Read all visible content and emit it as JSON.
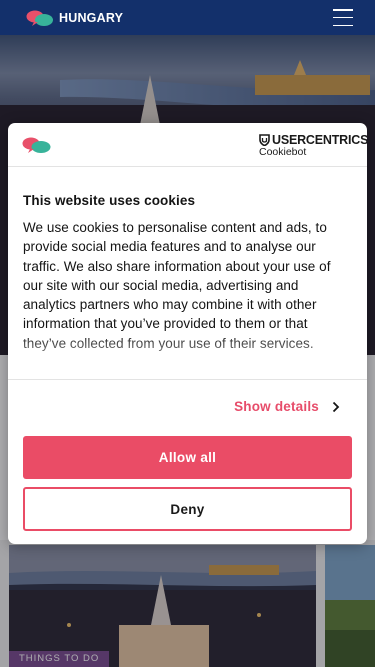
{
  "header": {
    "logo_text": "HUNGARY",
    "menu_icon": "hamburger-menu-icon"
  },
  "background": {
    "card_tag": "THINGS TO DO"
  },
  "cookie_dialog": {
    "brand_name": "USERCENTRICS",
    "brand_product": "Cookiebot",
    "title": "This website uses cookies",
    "body": "We use cookies to personalise content and ads, to provide social media features and to analyse our traffic. We also share information about your use of our site with our social media, advertising and analytics partners who may combine it with other information that you’ve provided to them or that they’ve collected from your use of their services.",
    "show_details": "Show details",
    "allow_all": "Allow all",
    "deny": "Deny"
  },
  "colors": {
    "header_bg": "#13306b",
    "accent": "#ea4c66",
    "tag_bg": "#7a4b8f"
  }
}
